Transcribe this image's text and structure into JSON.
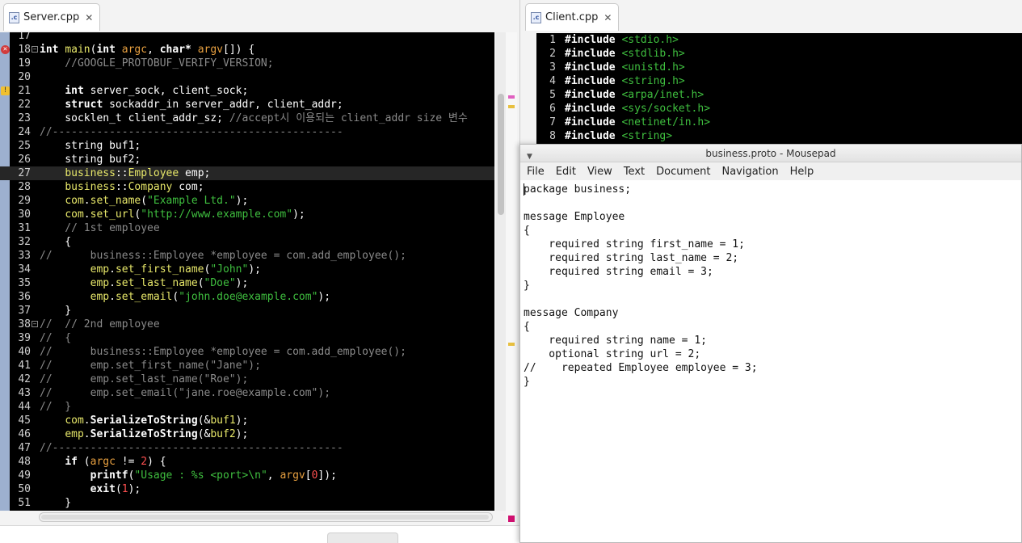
{
  "left_editor": {
    "tab_label": "Server.cpp",
    "lines": [
      {
        "n": "17",
        "segs": []
      },
      {
        "n": "18",
        "marker": "err",
        "fold": true,
        "segs": [
          [
            "k",
            "int "
          ],
          [
            "f",
            "main"
          ],
          [
            "t",
            "("
          ],
          [
            "k",
            "int "
          ],
          [
            "v",
            "argc"
          ],
          [
            "t",
            ", "
          ],
          [
            "k",
            "char* "
          ],
          [
            "v",
            "argv"
          ],
          [
            "t",
            "[]) {"
          ]
        ]
      },
      {
        "n": "19",
        "segs": [
          [
            "c",
            "    //GOOGLE_PROTOBUF_VERIFY_VERSION;"
          ]
        ]
      },
      {
        "n": "20",
        "segs": []
      },
      {
        "n": "21",
        "marker": "warn",
        "segs": [
          [
            "t",
            "    "
          ],
          [
            "k",
            "int "
          ],
          [
            "t",
            "server_sock, client_sock;"
          ]
        ]
      },
      {
        "n": "22",
        "segs": [
          [
            "t",
            "    "
          ],
          [
            "k",
            "struct "
          ],
          [
            "t",
            "sockaddr_in server_addr, client_addr;"
          ]
        ]
      },
      {
        "n": "23",
        "segs": [
          [
            "t",
            "    socklen_t client_addr_sz; "
          ],
          [
            "c",
            "//accept시 이용되는 client_addr size 변수"
          ]
        ]
      },
      {
        "n": "24",
        "segs": [
          [
            "c",
            "//----------------------------------------------"
          ]
        ]
      },
      {
        "n": "25",
        "segs": [
          [
            "t",
            "    string buf1;"
          ]
        ]
      },
      {
        "n": "26",
        "segs": [
          [
            "t",
            "    string buf2;"
          ]
        ]
      },
      {
        "n": "27",
        "current": true,
        "segs": [
          [
            "t",
            "    "
          ],
          [
            "f",
            "business"
          ],
          [
            "t",
            "::"
          ],
          [
            "f",
            "Employee"
          ],
          [
            "t",
            " emp;"
          ]
        ]
      },
      {
        "n": "28",
        "segs": [
          [
            "t",
            "    "
          ],
          [
            "f",
            "business"
          ],
          [
            "t",
            "::"
          ],
          [
            "f",
            "Company"
          ],
          [
            "t",
            " com;"
          ]
        ]
      },
      {
        "n": "29",
        "segs": [
          [
            "t",
            "    "
          ],
          [
            "f",
            "com"
          ],
          [
            "t",
            "."
          ],
          [
            "f",
            "set_name"
          ],
          [
            "t",
            "("
          ],
          [
            "s",
            "\"Example Ltd.\""
          ],
          [
            "t",
            ");"
          ]
        ]
      },
      {
        "n": "30",
        "segs": [
          [
            "t",
            "    "
          ],
          [
            "f",
            "com"
          ],
          [
            "t",
            "."
          ],
          [
            "f",
            "set_url"
          ],
          [
            "t",
            "("
          ],
          [
            "s",
            "\"http://www.example.com\""
          ],
          [
            "t",
            ");"
          ]
        ]
      },
      {
        "n": "31",
        "segs": [
          [
            "c",
            "    // 1st employee"
          ]
        ]
      },
      {
        "n": "32",
        "segs": [
          [
            "t",
            "    {"
          ]
        ]
      },
      {
        "n": "33",
        "segs": [
          [
            "c",
            "//      business::Employee *employee = com.add_employee();"
          ]
        ]
      },
      {
        "n": "34",
        "segs": [
          [
            "t",
            "        "
          ],
          [
            "f",
            "emp"
          ],
          [
            "t",
            "."
          ],
          [
            "f",
            "set_first_name"
          ],
          [
            "t",
            "("
          ],
          [
            "s",
            "\"John\""
          ],
          [
            "t",
            ");"
          ]
        ]
      },
      {
        "n": "35",
        "segs": [
          [
            "t",
            "        "
          ],
          [
            "f",
            "emp"
          ],
          [
            "t",
            "."
          ],
          [
            "f",
            "set_last_name"
          ],
          [
            "t",
            "("
          ],
          [
            "s",
            "\"Doe\""
          ],
          [
            "t",
            ");"
          ]
        ]
      },
      {
        "n": "36",
        "segs": [
          [
            "t",
            "        "
          ],
          [
            "f",
            "emp"
          ],
          [
            "t",
            "."
          ],
          [
            "f",
            "set_email"
          ],
          [
            "t",
            "("
          ],
          [
            "s",
            "\"john.doe@example.com\""
          ],
          [
            "t",
            ");"
          ]
        ]
      },
      {
        "n": "37",
        "segs": [
          [
            "t",
            "    }"
          ]
        ]
      },
      {
        "n": "38",
        "fold": true,
        "segs": [
          [
            "c",
            "//  // 2nd employee"
          ]
        ]
      },
      {
        "n": "39",
        "segs": [
          [
            "c",
            "//  {"
          ]
        ]
      },
      {
        "n": "40",
        "segs": [
          [
            "c",
            "//      business::Employee *employee = com.add_employee();"
          ]
        ]
      },
      {
        "n": "41",
        "segs": [
          [
            "c",
            "//      emp.set_first_name(\"Jane\");"
          ]
        ]
      },
      {
        "n": "42",
        "segs": [
          [
            "c",
            "//      emp.set_last_name(\"Roe\");"
          ]
        ]
      },
      {
        "n": "43",
        "segs": [
          [
            "c",
            "//      emp.set_email(\"jane.roe@example.com\");"
          ]
        ]
      },
      {
        "n": "44",
        "segs": [
          [
            "c",
            "//  }"
          ]
        ]
      },
      {
        "n": "45",
        "segs": [
          [
            "t",
            "    "
          ],
          [
            "f",
            "com"
          ],
          [
            "t",
            "."
          ],
          [
            "k",
            "SerializeToString"
          ],
          [
            "t",
            "(&"
          ],
          [
            "f",
            "buf1"
          ],
          [
            "t",
            ");"
          ]
        ]
      },
      {
        "n": "46",
        "segs": [
          [
            "t",
            "    "
          ],
          [
            "f",
            "emp"
          ],
          [
            "t",
            "."
          ],
          [
            "k",
            "SerializeToString"
          ],
          [
            "t",
            "(&"
          ],
          [
            "f",
            "buf2"
          ],
          [
            "t",
            ");"
          ]
        ]
      },
      {
        "n": "47",
        "segs": [
          [
            "c",
            "//----------------------------------------------"
          ]
        ]
      },
      {
        "n": "48",
        "segs": [
          [
            "t",
            "    "
          ],
          [
            "k",
            "if "
          ],
          [
            "t",
            "("
          ],
          [
            "v",
            "argc"
          ],
          [
            "t",
            " != "
          ],
          [
            "n",
            "2"
          ],
          [
            "t",
            ") {"
          ]
        ]
      },
      {
        "n": "49",
        "segs": [
          [
            "t",
            "        "
          ],
          [
            "k",
            "printf"
          ],
          [
            "t",
            "("
          ],
          [
            "s",
            "\"Usage : %s <port>\\n\""
          ],
          [
            "t",
            ", "
          ],
          [
            "v",
            "argv"
          ],
          [
            "t",
            "["
          ],
          [
            "n",
            "0"
          ],
          [
            "t",
            "]);"
          ]
        ]
      },
      {
        "n": "50",
        "segs": [
          [
            "t",
            "        "
          ],
          [
            "k",
            "exit"
          ],
          [
            "t",
            "("
          ],
          [
            "n",
            "1"
          ],
          [
            "t",
            ");"
          ]
        ]
      },
      {
        "n": "51",
        "segs": [
          [
            "t",
            "    }"
          ]
        ]
      }
    ]
  },
  "right_editor": {
    "tab_label": "Client.cpp",
    "lines": [
      {
        "n": "1",
        "dir": "#include ",
        "arg": "<stdio.h>"
      },
      {
        "n": "2",
        "dir": "#include ",
        "arg": "<stdlib.h>"
      },
      {
        "n": "3",
        "dir": "#include ",
        "arg": "<unistd.h>"
      },
      {
        "n": "4",
        "dir": "#include ",
        "arg": "<string.h>"
      },
      {
        "n": "5",
        "dir": "#include ",
        "arg": "<arpa/inet.h>"
      },
      {
        "n": "6",
        "dir": "#include ",
        "arg": "<sys/socket.h>"
      },
      {
        "n": "7",
        "dir": "#include ",
        "arg": "<netinet/in.h>"
      },
      {
        "n": "8",
        "dir": "#include ",
        "arg": "<string>"
      }
    ]
  },
  "mousepad": {
    "title": "business.proto - Mousepad",
    "menu": [
      "File",
      "Edit",
      "View",
      "Text",
      "Document",
      "Navigation",
      "Help"
    ],
    "lines": [
      "package business;",
      "",
      "message Employee",
      "{",
      "    required string first_name = 1;",
      "    required string last_name = 2;",
      "    required string email = 3;",
      "}",
      "",
      "message Company",
      "{",
      "    required string name = 1;",
      "    optional string url = 2;",
      "//    repeated Employee employee = 3;",
      "}"
    ]
  },
  "icons": {
    "tab_file": "c-file-icon",
    "tab_close": "close-icon",
    "error_marker": "error-icon",
    "warning_marker": "warning-icon"
  },
  "colors": {
    "editor_bg": "#000000",
    "string": "#3fbf3f",
    "comment": "#8a8a8a",
    "field": "#e8e86a"
  }
}
